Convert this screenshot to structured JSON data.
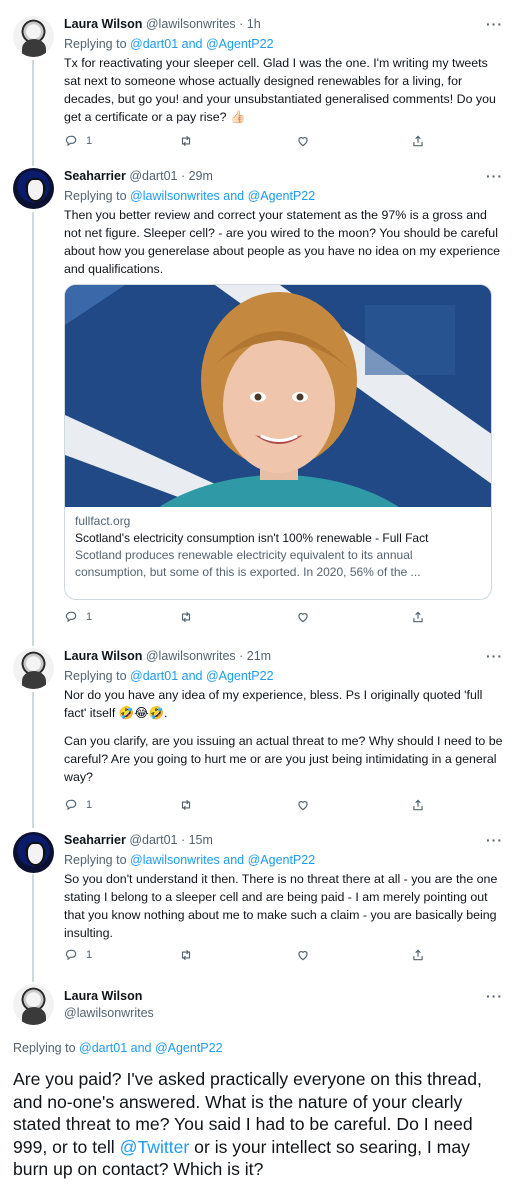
{
  "tweets": [
    {
      "name": "Laura Wilson",
      "handle": "@lawilsonwrites",
      "time": "· 1h",
      "replying_prefix": "Replying to ",
      "replying_to": "@dart01 and @AgentP22",
      "text": "Tx for reactivating your sleeper cell. Glad I was the one. I'm writing my tweets sat next to someone whose actually designed renewables for a living, for decades, but go you! and your unsubstantiated generalised comments! Do you get a certificate or a pay rise? 👍🏻",
      "reply_count": "1"
    },
    {
      "name": "Seaharrier",
      "handle": "@dart01",
      "time": "· 29m",
      "replying_prefix": "Replying to ",
      "replying_to": "@lawilsonwrites and @AgentP22",
      "text": "Then you better review and correct your statement as the 97% is a gross and not net figure. Sleeper cell? - are you wired to the moon? You should be careful about how you generelase about people as you have no idea on my experience and qualifications.",
      "reply_count": "1",
      "card": {
        "domain": "fullfact.org",
        "title": "Scotland's electricity consumption isn't 100% renewable - Full Fact",
        "description": "Scotland produces renewable electricity equivalent to its annual consumption, but some of this is exported. In 2020, 56% of the ..."
      }
    },
    {
      "name": "Laura Wilson",
      "handle": "@lawilsonwrites",
      "time": "· 21m",
      "replying_prefix": "Replying to ",
      "replying_to": "@dart01 and @AgentP22",
      "text_1": "Nor do you have any idea of my experience, bless. Ps I originally quoted 'full fact' itself 🤣😂🤣.",
      "text_2": "Can you clarify, are you issuing an actual threat to me? Why should I need to be careful? Are you going to hurt me or are you just being intimidating in a general way?",
      "reply_count": "1"
    },
    {
      "name": "Seaharrier",
      "handle": "@dart01",
      "time": "· 15m",
      "replying_prefix": "Replying to ",
      "replying_to": "@lawilsonwrites and @AgentP22",
      "text": "So you don't understand it then. There is no threat there at all - you are the one stating I belong to a sleeper cell and are being paid - I am merely pointing out that you know nothing about me to make such a claim - you are basically being insulting.",
      "reply_count": "1"
    }
  ],
  "focused": {
    "name": "Laura Wilson",
    "handle": "@lawilsonwrites",
    "replying_prefix": "Replying to ",
    "replying_to": "@dart01 and @AgentP22",
    "text_before": "Are you paid? I've asked practically everyone on this thread, and no-one's answered. What is the nature of your clearly stated threat to me? You said I had to be careful. Do I need 999, or to tell ",
    "mention": "@Twitter",
    "text_after": "  or is your intellect so searing, I may burn up on contact? Which is it?"
  },
  "icons": {
    "reply": "reply-icon",
    "retweet": "retweet-icon",
    "like": "like-icon",
    "share": "share-icon",
    "more": "more-icon"
  },
  "colors": {
    "link": "#1d9bf0",
    "muted": "#536471",
    "text": "#0f1419",
    "line": "#cfd9de"
  }
}
